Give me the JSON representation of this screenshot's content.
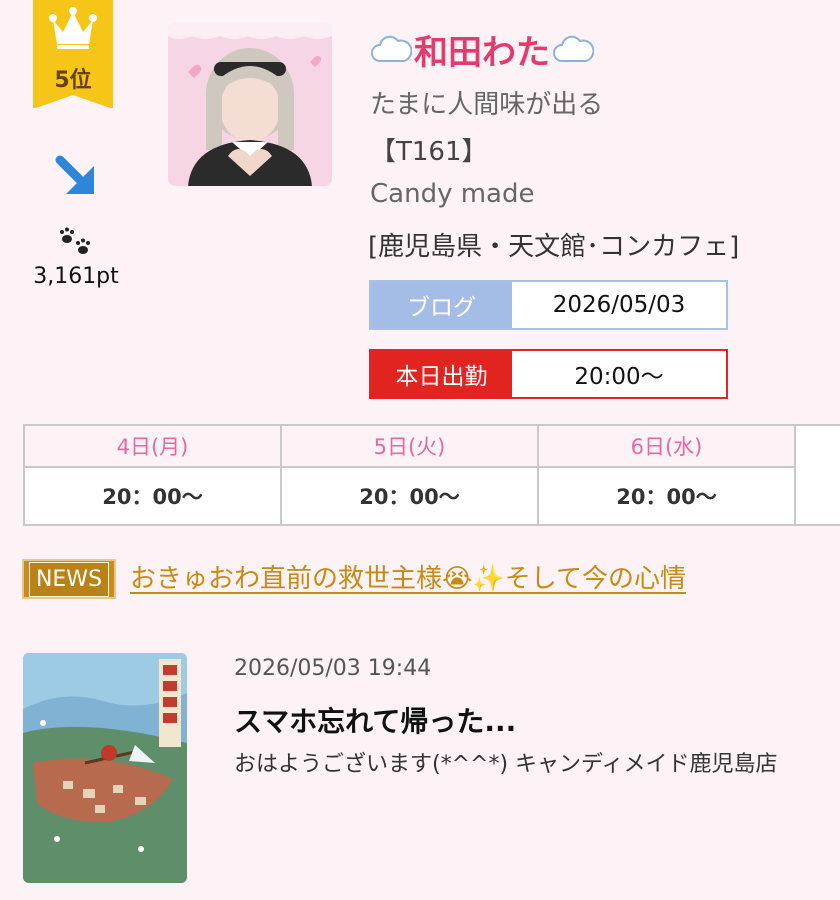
{
  "rank": {
    "label": "5位",
    "trend": "down-right",
    "points": "3,161pt",
    "colors": {
      "ribbon": "#f5c518",
      "arrow": "#2f86d8"
    }
  },
  "profile": {
    "name": "和田わた",
    "tagline": "たまに人間味が出る",
    "height": "【T161】",
    "shop": "Candy made",
    "area": "[鹿児島県・天文館･コンカフェ]",
    "name_color": "#e23b6e"
  },
  "blog": {
    "label": "ブログ",
    "date": "2026/05/03"
  },
  "attendance": {
    "label": "本日出勤",
    "time": "20:00〜"
  },
  "schedule": [
    {
      "day": "4日(月)",
      "time": "20：00〜"
    },
    {
      "day": "5日(火)",
      "time": "20：00〜"
    },
    {
      "day": "6日(水)",
      "time": "20：00〜"
    }
  ],
  "news": {
    "badge": "NEWS",
    "link_text": "おきゅおわ直前の救世主様😭✨そして今の心情"
  },
  "post": {
    "datetime": "2026/05/03 19:44",
    "title": "スマホ忘れて帰った...",
    "excerpt": "おはようございます(*^^*) キャンディメイド鹿児島店"
  },
  "icons": {
    "rank": "crown-icon",
    "trend": "arrow-down-right-icon",
    "points": "paw-icon",
    "name_decor": "cloud-icon"
  }
}
